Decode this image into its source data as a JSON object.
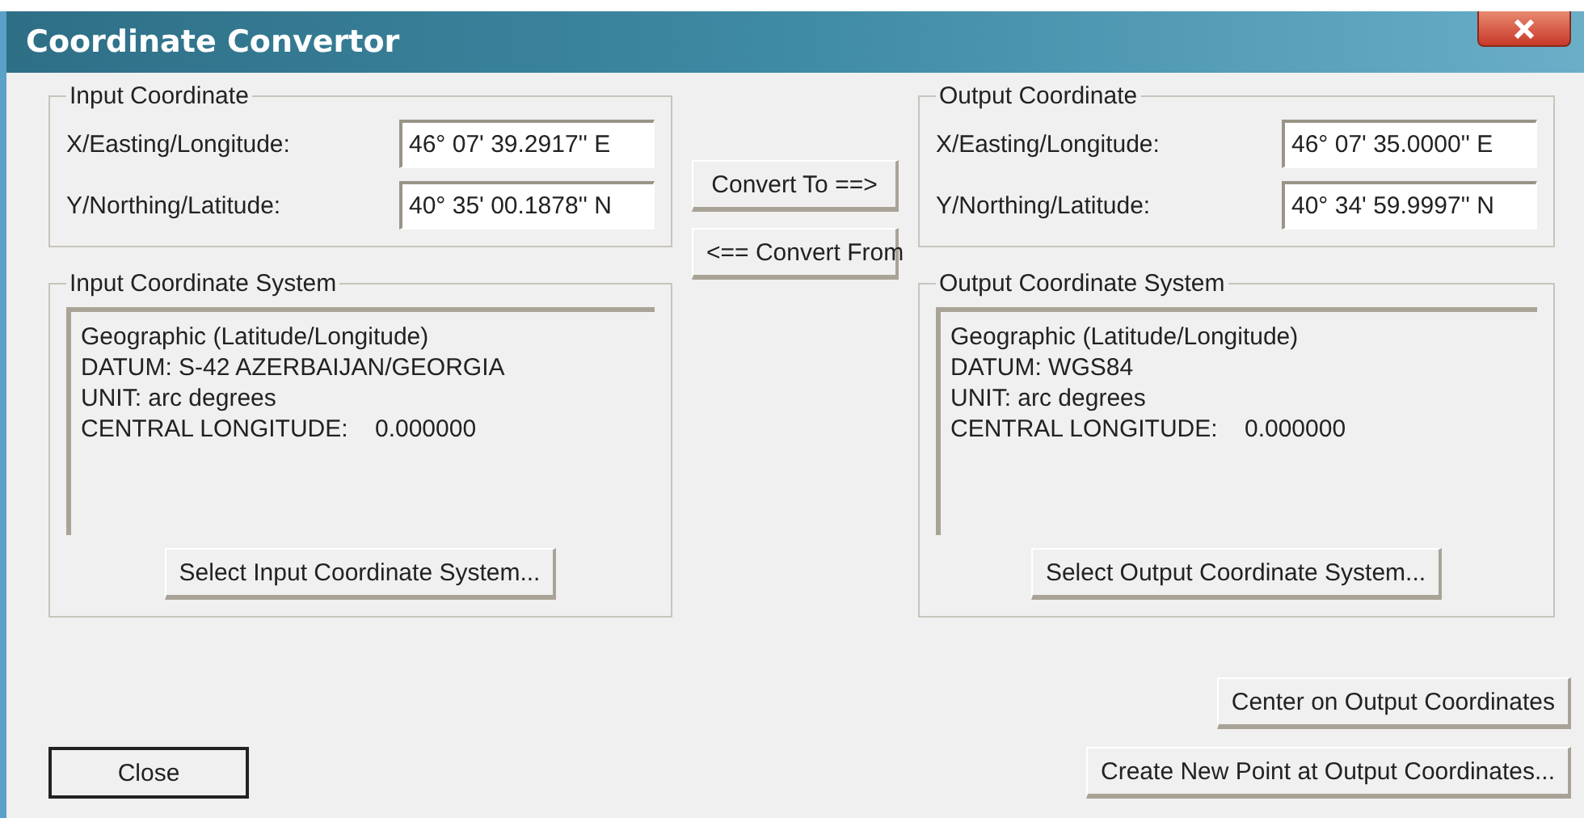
{
  "window": {
    "title": "Coordinate Convertor"
  },
  "input_coordinate": {
    "title": "Input Coordinate",
    "fields": [
      {
        "label": "X/Easting/Longitude:",
        "value": "46° 07' 39.2917'' E"
      },
      {
        "label": "Y/Northing/Latitude:",
        "value": "40° 35' 00.1878'' N"
      }
    ]
  },
  "convert_buttons": [
    "Convert To ==>",
    "<== Convert From"
  ],
  "output_coordinate": {
    "title": "Output Coordinate",
    "fields": [
      {
        "label": "X/Easting/Longitude:",
        "value": "46° 07' 35.0000'' E"
      },
      {
        "label": "Y/Northing/Latitude:",
        "value": "40° 34' 59.9997'' N"
      }
    ]
  },
  "input_system": {
    "title": "Input Coordinate System",
    "lines": [
      "Geographic (Latitude/Longitude)",
      "DATUM: S-42 AZERBAIJAN/GEORGIA",
      "UNIT: arc degrees",
      "CENTRAL LONGITUDE:    0.000000"
    ],
    "button": "Select Input Coordinate System..."
  },
  "output_system": {
    "title": "Output Coordinate System",
    "lines": [
      "Geographic (Latitude/Longitude)",
      "DATUM: WGS84",
      "UNIT: arc degrees",
      "CENTRAL LONGITUDE:    0.000000"
    ],
    "button": "Select Output Coordinate System..."
  },
  "close_button": "Close",
  "action_buttons": [
    "Center on Output Coordinates",
    "Create New Point at Output Coordinates..."
  ]
}
